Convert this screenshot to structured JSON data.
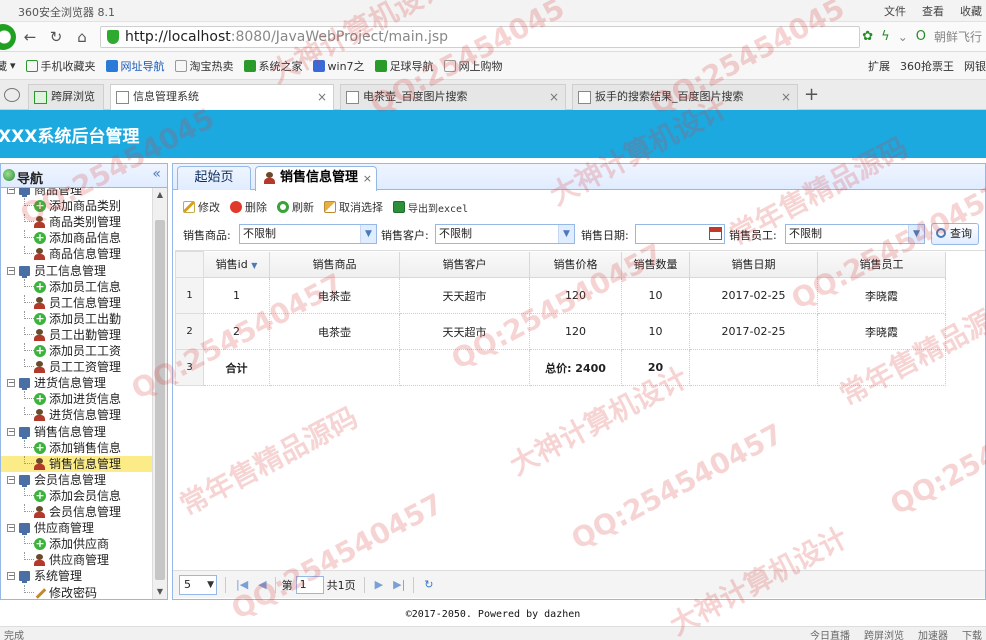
{
  "browser": {
    "window_title": "360安全浏览器 8.1",
    "menu": [
      "文件",
      "查看",
      "收藏"
    ],
    "url_host": "http://localhost",
    "url_rest": ":8080/JavaWebProject/main.jsp",
    "addr_right_text": "朝鲜飞行",
    "bookmarks": [
      "藏",
      "手机收藏夹",
      "网址导航",
      "淘宝热卖",
      "系统之家",
      "win7之",
      "足球导航",
      "网上购物"
    ],
    "bookmarks_right": [
      "扩展",
      "360抢票王",
      "网银"
    ],
    "tabs": [
      {
        "label": "跨屏浏览"
      },
      {
        "label": "信息管理系统"
      },
      {
        "label": "电茶壶_百度图片搜索"
      },
      {
        "label": "扳手的搜索结果_百度图片搜索"
      }
    ]
  },
  "app": {
    "title": "XXX系统后台管理"
  },
  "sidebar": {
    "title": "导航",
    "collapse_glyph": "«",
    "tree": [
      {
        "label": "商品管理",
        "type": "group"
      },
      {
        "label": "添加商品类别",
        "type": "add"
      },
      {
        "label": "商品类别管理",
        "type": "user"
      },
      {
        "label": "添加商品信息",
        "type": "add"
      },
      {
        "label": "商品信息管理",
        "type": "user"
      },
      {
        "label": "员工信息管理",
        "type": "group"
      },
      {
        "label": "添加员工信息",
        "type": "add"
      },
      {
        "label": "员工信息管理",
        "type": "user"
      },
      {
        "label": "添加员工出勤",
        "type": "add"
      },
      {
        "label": "员工出勤管理",
        "type": "user"
      },
      {
        "label": "添加员工工资",
        "type": "add"
      },
      {
        "label": "员工工资管理",
        "type": "user"
      },
      {
        "label": "进货信息管理",
        "type": "group"
      },
      {
        "label": "添加进货信息",
        "type": "add"
      },
      {
        "label": "进货信息管理",
        "type": "user"
      },
      {
        "label": "销售信息管理",
        "type": "group"
      },
      {
        "label": "添加销售信息",
        "type": "add"
      },
      {
        "label": "销售信息管理",
        "type": "user",
        "selected": true
      },
      {
        "label": "会员信息管理",
        "type": "group"
      },
      {
        "label": "添加会员信息",
        "type": "add"
      },
      {
        "label": "会员信息管理",
        "type": "user"
      },
      {
        "label": "供应商管理",
        "type": "group"
      },
      {
        "label": "添加供应商",
        "type": "add"
      },
      {
        "label": "供应商管理",
        "type": "user"
      },
      {
        "label": "系统管理",
        "type": "group"
      },
      {
        "label": "修改密码",
        "type": "pen"
      }
    ]
  },
  "main": {
    "tabs": [
      {
        "label": "起始页"
      },
      {
        "label": "销售信息管理",
        "close": "×"
      }
    ],
    "toolbar": {
      "edit": "修改",
      "delete": "删除",
      "refresh": "刷新",
      "cancel_select": "取消选择",
      "export": "导出到excel"
    },
    "filters": {
      "product_label": "销售商品:",
      "product_value": "不限制",
      "customer_label": "销售客户:",
      "customer_value": "不限制",
      "date_label": "销售日期:",
      "date_value": "",
      "employee_label": "销售员工:",
      "employee_value": "不限制",
      "search_label": "查询"
    },
    "table": {
      "columns": [
        "销售id",
        "销售商品",
        "销售客户",
        "销售价格",
        "销售数量",
        "销售日期",
        "销售员工"
      ],
      "sort_caret": "▼",
      "rows": [
        {
          "rownum": "1",
          "cells": [
            "1",
            "电茶壶",
            "天天超市",
            "120",
            "10",
            "2017-02-25",
            "李晓霞"
          ]
        },
        {
          "rownum": "2",
          "cells": [
            "2",
            "电茶壶",
            "天天超市",
            "120",
            "10",
            "2017-02-25",
            "李晓霞"
          ]
        },
        {
          "rownum": "3",
          "cells": [
            "合计",
            "",
            "",
            "总价: 2400",
            "20",
            "",
            ""
          ]
        }
      ]
    },
    "pager": {
      "page_size": "5",
      "page_prefix": "第",
      "page_number": "1",
      "page_total": "共1页"
    }
  },
  "footer": {
    "text": "©2017-2050. Powered by dazhen"
  },
  "statusbar": {
    "left": "完成",
    "right": [
      "今日直播",
      "跨屏浏览",
      "加速器",
      "下载"
    ]
  },
  "watermarks": [
    "大神计算机设计",
    "QQ:25454045",
    "QQ:254540457",
    "常年售精品源码"
  ]
}
